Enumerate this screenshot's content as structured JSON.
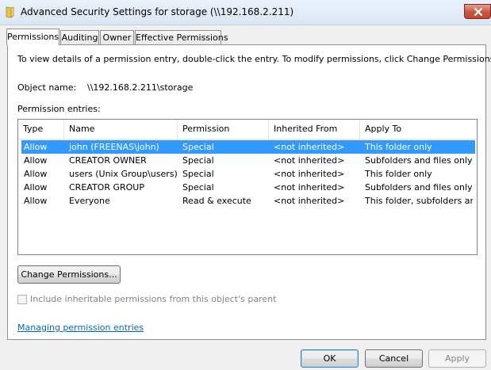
{
  "window": {
    "title": "Advanced Security Settings for storage (\\\\192.168.2.211)"
  },
  "tabs": [
    {
      "label": "Permissions",
      "active": true
    },
    {
      "label": "Auditing"
    },
    {
      "label": "Owner"
    },
    {
      "label": "Effective Permissions"
    }
  ],
  "permissions_tab": {
    "info_text": "To view details of a permission entry, double-click the entry. To modify permissions, click Change Permissions.",
    "object_name_label": "Object name:",
    "object_name_value": "\\\\192.168.2.211\\storage",
    "entries_label": "Permission entries:",
    "columns": [
      "Type",
      "Name",
      "Permission",
      "Inherited From",
      "Apply To"
    ],
    "rows": [
      {
        "type": "Allow",
        "name": "john (FREENAS\\john)",
        "permission": "Special",
        "inherited_from": "<not inherited>",
        "apply_to": "This folder only",
        "selected": true
      },
      {
        "type": "Allow",
        "name": "CREATOR OWNER",
        "permission": "Special",
        "inherited_from": "<not inherited>",
        "apply_to": "Subfolders and files only"
      },
      {
        "type": "Allow",
        "name": "users (Unix Group\\users)",
        "permission": "Special",
        "inherited_from": "<not inherited>",
        "apply_to": "This folder only"
      },
      {
        "type": "Allow",
        "name": "CREATOR GROUP",
        "permission": "Special",
        "inherited_from": "<not inherited>",
        "apply_to": "Subfolders and files only"
      },
      {
        "type": "Allow",
        "name": "Everyone",
        "permission": "Read & execute",
        "inherited_from": "<not inherited>",
        "apply_to": "This folder, subfolders and..."
      }
    ],
    "change_permissions_label": "Change Permissions...",
    "inherit_checkbox_label": "Include inheritable permissions from this object's parent",
    "inherit_checked": false,
    "help_link": "Managing permission entries"
  },
  "footer": {
    "ok_label": "OK",
    "cancel_label": "Cancel",
    "apply_label": "Apply"
  },
  "colors": {
    "selection": "#3399ff",
    "link": "#0066cc",
    "panel_bg": "#ffffff",
    "dialog_bg": "#f0f0f0"
  }
}
